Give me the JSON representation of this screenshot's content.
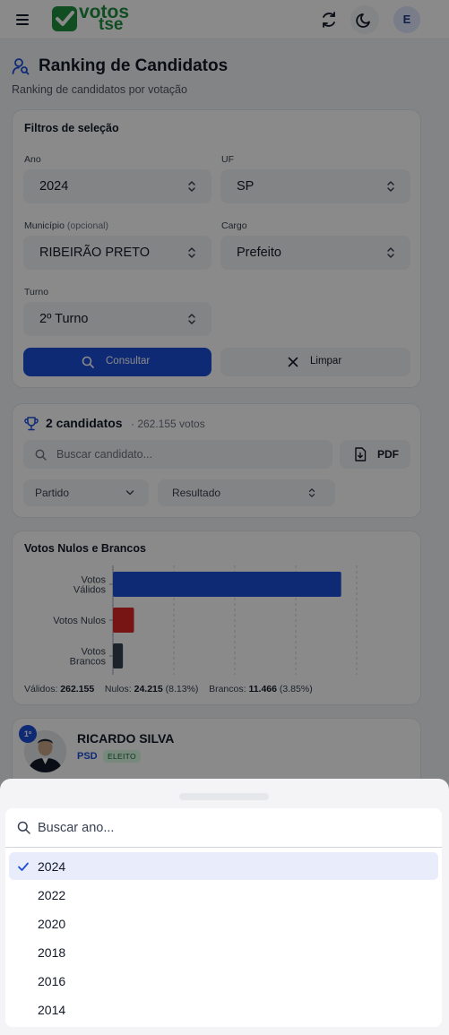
{
  "header": {
    "logo_line1": "votos",
    "logo_line2": "tse",
    "avatar_initial": "E",
    "icons": {
      "menu": "menu-icon",
      "refresh": "refresh-icon",
      "theme": "moon-icon"
    }
  },
  "page": {
    "title": "Ranking de Candidatos",
    "subtitle": "Ranking de candidatos por votação"
  },
  "filters": {
    "card_title": "Filtros de seleção",
    "ano_label": "Ano",
    "ano_value": "2024",
    "uf_label": "UF",
    "uf_value": "SP",
    "municipio_label": "Município",
    "municipio_optional": "(opcional)",
    "municipio_value": "RIBEIRÃO PRETO",
    "cargo_label": "Cargo",
    "cargo_value": "Prefeito",
    "turno_label": "Turno",
    "turno_value": "2º Turno",
    "consultar_label": "Consultar",
    "limpar_label": "Limpar"
  },
  "results": {
    "count_label": "2 candidatos",
    "votes_label": "· 262.155 votos",
    "search_placeholder": "Buscar candidato...",
    "pdf_label": "PDF",
    "partido_filter": "Partido",
    "resultado_filter": "Resultado"
  },
  "chart_section": {
    "title": "Votos Nulos e Brancos",
    "footer": {
      "validos_label": "Válidos:",
      "validos_value": "262.155",
      "nulos_label": "Nulos:",
      "nulos_value": "24.215",
      "nulos_pct": "(8.13%)",
      "brancos_label": "Brancos:",
      "brancos_value": "11.466",
      "brancos_pct": "(3.85%)"
    }
  },
  "chart_data": {
    "type": "bar",
    "orientation": "horizontal",
    "categories": [
      "Votos Válidos",
      "Votos Nulos",
      "Votos Brancos"
    ],
    "values": [
      262155,
      24215,
      11466
    ],
    "colors": [
      "#1d4ed8",
      "#dc2626",
      "#374151"
    ],
    "title": "Votos Nulos e Brancos",
    "xlim": [
      0,
      280000
    ],
    "grid": true
  },
  "candidate": {
    "rank": "1º",
    "name": "RICARDO SILVA",
    "party": "PSD",
    "status": "ELEITO"
  },
  "year_picker": {
    "search_placeholder": "Buscar ano...",
    "selected": "2024",
    "options": [
      "2024",
      "2022",
      "2020",
      "2018",
      "2016",
      "2014"
    ]
  }
}
